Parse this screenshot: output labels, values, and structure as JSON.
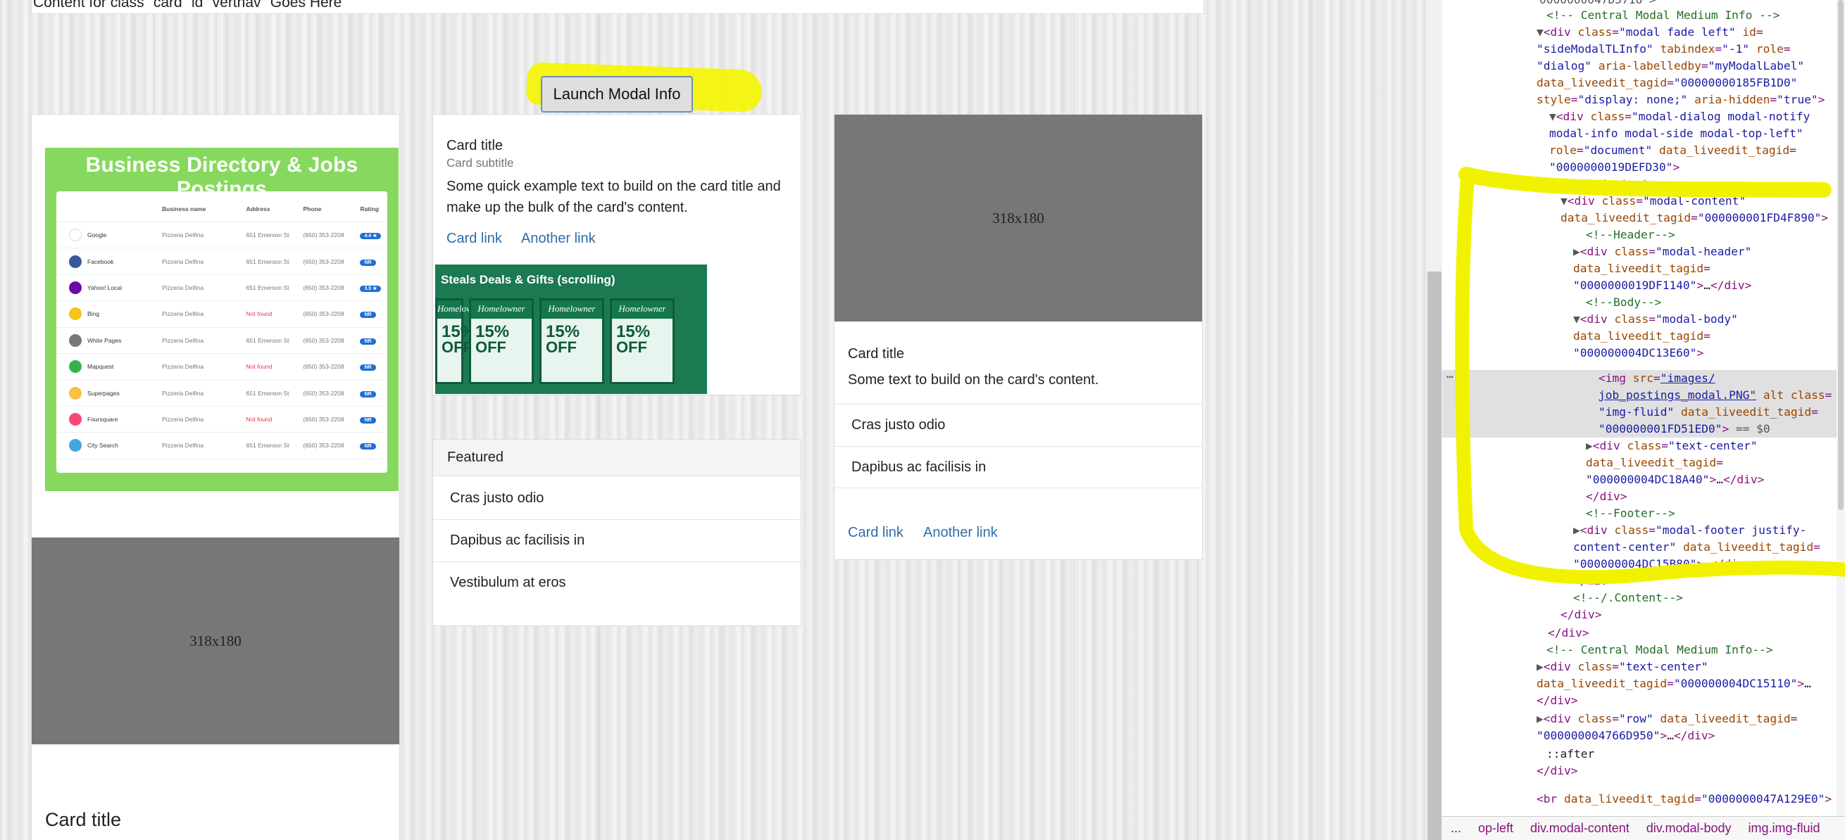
{
  "page": {
    "top_content": "Content for class \"card\" id \"verthav\" Goes Here",
    "launch_button": "Launch Modal Info"
  },
  "col1": {
    "directory_image": {
      "title": "Business Directory & Jobs Postings",
      "headers": [
        "Business name",
        "Address",
        "Phone",
        "Rating"
      ],
      "rows": [
        {
          "name": "Google",
          "biz": "Pizzeria Delfina",
          "addr": "651 Emerson St",
          "phone": "(650) 353-2208",
          "rating": "4.4 ★",
          "color": "#ffffff"
        },
        {
          "name": "Facebook",
          "biz": "Pizzeria Delfina",
          "addr": "651 Emerson St",
          "phone": "(650) 353-2208",
          "rating": "NR",
          "color": "#3b5998"
        },
        {
          "name": "Yahoo! Local",
          "biz": "Pizzeria Delfina",
          "addr": "651 Emerson St",
          "phone": "(650) 353-2208",
          "rating": "3.5 ★",
          "color": "#6b0ba1"
        },
        {
          "name": "Bing",
          "biz": "Pizzeria Delfina",
          "addr": "Not found",
          "phone": "(650) 353-2208",
          "rating": "NR",
          "color": "#f5c518"
        },
        {
          "name": "White Pages",
          "biz": "Pizzeria Delfina",
          "addr": "651 Emerson St",
          "phone": "(650) 353-2208",
          "rating": "NR",
          "color": "#777777"
        },
        {
          "name": "Mapquest",
          "biz": "Pizzeria Delfina",
          "addr": "Not found",
          "phone": "(650) 353-2208",
          "rating": "NR",
          "color": "#35b34a"
        },
        {
          "name": "Superpages",
          "biz": "Pizzeria Delfina",
          "addr": "651 Emerson St",
          "phone": "(650) 353-2208",
          "rating": "NR",
          "color": "#f6c244"
        },
        {
          "name": "Foursquare",
          "biz": "Pizzeria Delfina",
          "addr": "Not found",
          "phone": "(650) 353-2208",
          "rating": "NR",
          "color": "#f94877"
        },
        {
          "name": "City Search",
          "biz": "Pizzeria Delfina",
          "addr": "651 Emerson St",
          "phone": "(650) 353-2208",
          "rating": "NR",
          "color": "#3fa9e0"
        }
      ]
    },
    "placeholder": "318x180",
    "card_title": "Card title"
  },
  "col2": {
    "card_title": "Card title",
    "card_subtitle": "Card subtitle",
    "card_text": "Some quick example text to build on the card title and make up the bulk of the card's content.",
    "link1": "Card link",
    "link2": "Another link",
    "steals_title": "Steals Deals & Gifts (scrolling)",
    "coupon_brand": "Homelowner",
    "coupon_off": "15%",
    "coupon_off2": "OFF",
    "featured": "Featured",
    "list": [
      "Cras justo odio",
      "Dapibus ac facilisis in",
      "Vestibulum at eros"
    ]
  },
  "col3": {
    "placeholder": "318x180",
    "card_title": "Card title",
    "card_text": "Some text to build on the card's content.",
    "list": [
      "Cras justo odio",
      "Dapibus ac facilisis in"
    ],
    "link1": "Card link",
    "link2": "Another link"
  },
  "devtools": {
    "breadcrumbs": [
      "...",
      "op-left",
      "div.modal-content",
      "div.modal-body",
      "img.img-fluid"
    ]
  },
  "colors": {
    "highlight": "#f5f500",
    "link": "#2f6da8",
    "placeholder": "#777777"
  }
}
